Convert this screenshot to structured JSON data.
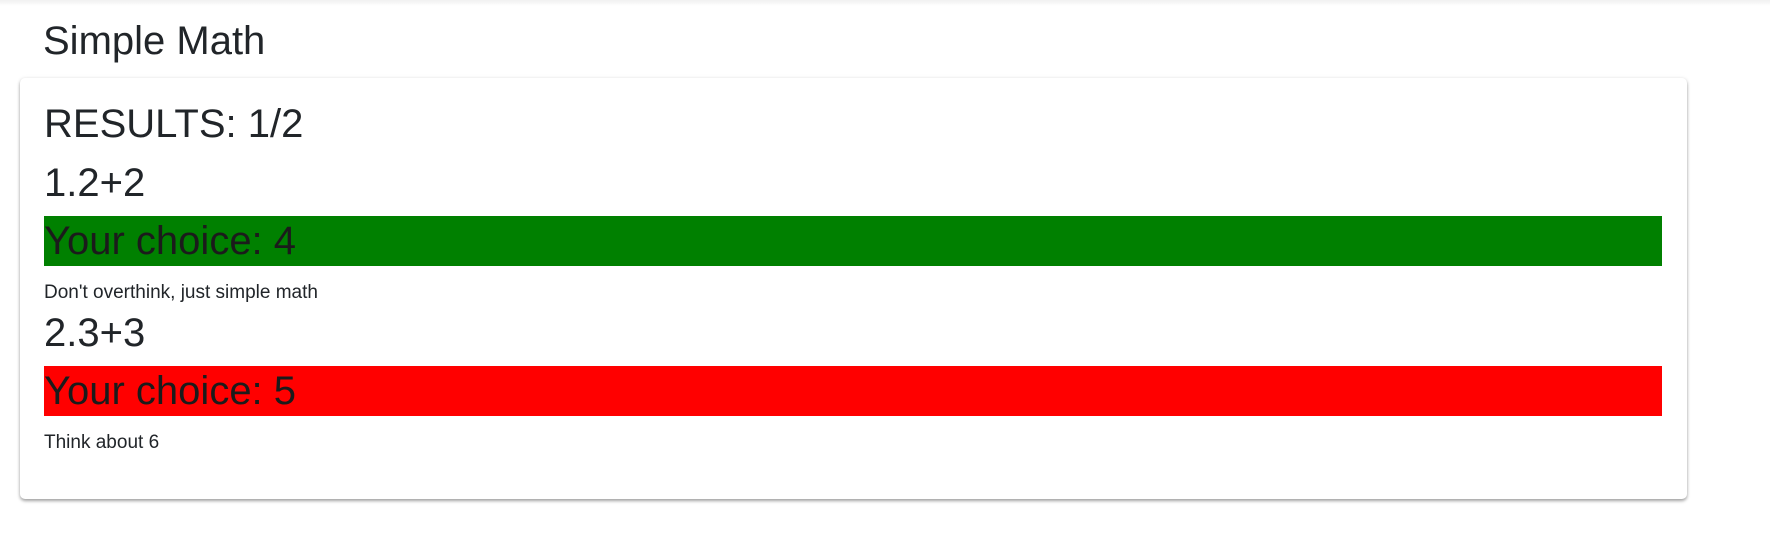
{
  "page": {
    "title": "Simple Math"
  },
  "results": {
    "text": "RESULTS: 1/2"
  },
  "questions": [
    {
      "title": "1.2+2",
      "choice_text": "Your choice: 4",
      "status": "correct",
      "hint": "Don't overthink, just simple math"
    },
    {
      "title": "2.3+3",
      "choice_text": "Your choice: 5",
      "status": "incorrect",
      "hint": "Think about 6"
    }
  ],
  "colors": {
    "correct": "#008000",
    "incorrect": "#ff0000",
    "text": "#212529",
    "card_background": "#ffffff"
  }
}
